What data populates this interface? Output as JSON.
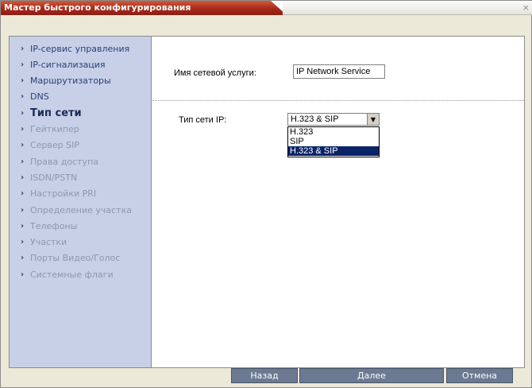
{
  "window": {
    "title": "Мастер быстрого конфигурирования",
    "close_glyph": "×"
  },
  "sidebar": {
    "items": [
      {
        "label": "IP-сервис управления",
        "state": "done"
      },
      {
        "label": "IP-сигнализация",
        "state": "done"
      },
      {
        "label": "Маршрутизаторы",
        "state": "done"
      },
      {
        "label": "DNS",
        "state": "done"
      },
      {
        "label": "Тип сети",
        "state": "active"
      },
      {
        "label": "Гейткипер",
        "state": "todo"
      },
      {
        "label": "Сервер SIP",
        "state": "todo"
      },
      {
        "label": "Права доступа",
        "state": "todo"
      },
      {
        "label": "ISDN/PSTN",
        "state": "todo"
      },
      {
        "label": "Настройки PRI",
        "state": "todo"
      },
      {
        "label": "Определение участка",
        "state": "todo"
      },
      {
        "label": "Телефоны",
        "state": "todo"
      },
      {
        "label": "Участки",
        "state": "todo"
      },
      {
        "label": "Порты Видео/Голос",
        "state": "todo"
      },
      {
        "label": "Системные флаги",
        "state": "todo"
      }
    ],
    "chevron_icon": "chevron-right-icon",
    "chevron_glyph": "›"
  },
  "form": {
    "service_label": "Имя сетевой услуги:",
    "service_value": "IP Network Service",
    "network_type_label": "Тип сети IP:",
    "network_type_value": "H.323 & SIP",
    "network_type_options": [
      "H.323",
      "SIP",
      "H.323 & SIP"
    ],
    "selected_option": "H.323 & SIP"
  },
  "buttons": {
    "back": "Назад",
    "next": "Далее",
    "cancel": "Отмена"
  },
  "colors": {
    "sidebar_bg": "#c7d0e6",
    "title_red": "#a8281a",
    "selection": "#0a246a",
    "button_bg": "#6b7a92"
  }
}
